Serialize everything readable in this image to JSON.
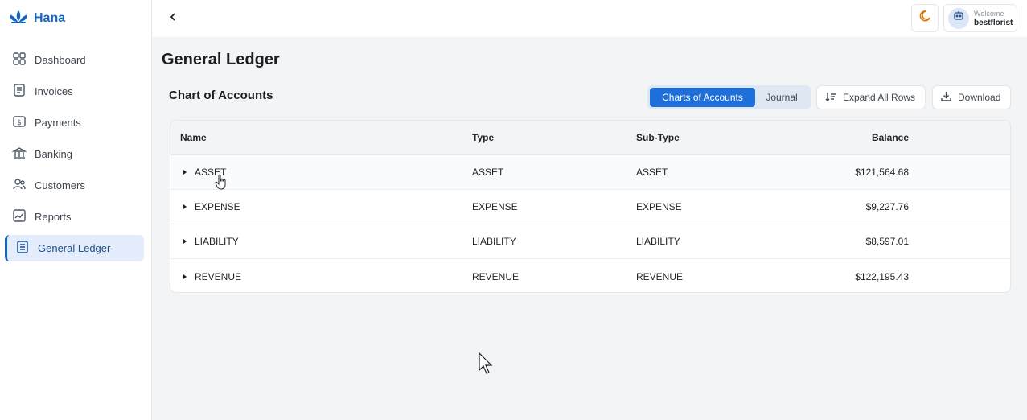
{
  "app": {
    "brand": "Hana",
    "brand_color": "#1565c0",
    "accent": "#1e6fd9"
  },
  "sidebar": {
    "items": [
      {
        "label": "Dashboard",
        "icon": "grid-icon"
      },
      {
        "label": "Invoices",
        "icon": "invoice-icon"
      },
      {
        "label": "Payments",
        "icon": "dollar-icon"
      },
      {
        "label": "Banking",
        "icon": "bank-icon"
      },
      {
        "label": "Customers",
        "icon": "users-icon"
      },
      {
        "label": "Reports",
        "icon": "chart-line-icon"
      },
      {
        "label": "General Ledger",
        "icon": "ledger-icon",
        "active": true
      }
    ]
  },
  "header": {
    "welcome": "Welcome",
    "username": "bestflorist"
  },
  "main": {
    "title": "General Ledger",
    "section_title": "Chart of Accounts",
    "tabs": [
      {
        "label": "Charts of Accounts",
        "selected": true
      },
      {
        "label": "Journal",
        "selected": false
      }
    ],
    "expand_label": "Expand All Rows",
    "download_label": "Download"
  },
  "table": {
    "columns": [
      "Name",
      "Type",
      "Sub-Type",
      "Balance"
    ],
    "rows": [
      {
        "name": "ASSET",
        "type": "ASSET",
        "subtype": "ASSET",
        "balance": "$121,564.68"
      },
      {
        "name": "EXPENSE",
        "type": "EXPENSE",
        "subtype": "EXPENSE",
        "balance": "$9,227.76"
      },
      {
        "name": "LIABILITY",
        "type": "LIABILITY",
        "subtype": "LIABILITY",
        "balance": "$8,597.01"
      },
      {
        "name": "REVENUE",
        "type": "REVENUE",
        "subtype": "REVENUE",
        "balance": "$122,195.43"
      }
    ]
  }
}
